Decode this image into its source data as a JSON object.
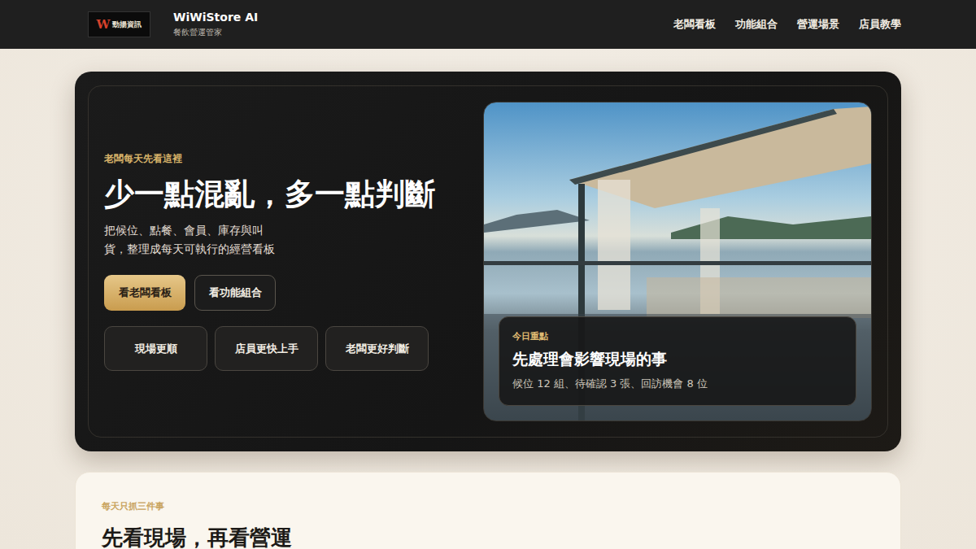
{
  "brand": {
    "logo_mark": "W",
    "logo_text": "勁揚資訊",
    "name": "WiWiStore AI",
    "subtitle": "餐飲營運管家"
  },
  "nav": [
    {
      "label": "老闆看板"
    },
    {
      "label": "功能組合"
    },
    {
      "label": "營運場景"
    },
    {
      "label": "店員教學"
    }
  ],
  "hero": {
    "eyebrow": "老闆每天先看這裡",
    "title": "少一點混亂，多一點判斷",
    "description": "把候位、點餐、會員、庫存與叫貨，整理成每天可執行的經營看板",
    "buttons": [
      {
        "label": "看老闆看板",
        "kind": "primary"
      },
      {
        "label": "看功能組合",
        "kind": "secondary"
      }
    ],
    "chips": [
      {
        "label": "現場更順"
      },
      {
        "label": "店員更快上手"
      },
      {
        "label": "老闆更好判斷"
      }
    ],
    "highlight": {
      "label": "今日重點",
      "title": "先處理會影響現場的事",
      "detail": "候位 12 組、待確認 3 張、回訪機會 8 位"
    }
  },
  "section": {
    "eyebrow": "每天只抓三件事",
    "title": "先看現場，再看營運"
  }
}
